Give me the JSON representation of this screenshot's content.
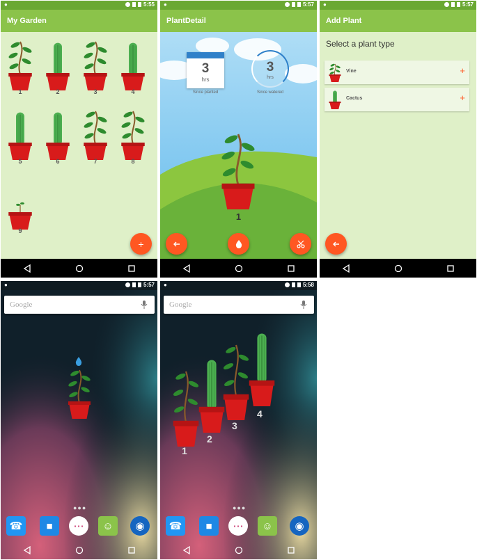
{
  "status": {
    "time1": "5:55",
    "time2": "5:57",
    "time3": "5:57",
    "time4": "5:57",
    "time5": "5:58"
  },
  "garden": {
    "title": "My Garden",
    "plants": [
      {
        "num": "1",
        "type": "vine"
      },
      {
        "num": "2",
        "type": "cactus"
      },
      {
        "num": "3",
        "type": "vine"
      },
      {
        "num": "4",
        "type": "cactus"
      },
      {
        "num": "5",
        "type": "cactus"
      },
      {
        "num": "6",
        "type": "cactus"
      },
      {
        "num": "7",
        "type": "vine"
      },
      {
        "num": "8",
        "type": "vine"
      },
      {
        "num": "9",
        "type": "sprout"
      }
    ],
    "fab_label": "+"
  },
  "detail": {
    "title": "PlantDetail",
    "planted_value": "3",
    "planted_unit": "hrs",
    "planted_label": "Since planted",
    "watered_value": "3",
    "watered_unit": "hrs",
    "watered_label": "Since watered",
    "plant_number": "1"
  },
  "add": {
    "title": "Add Plant",
    "heading": "Select a plant type",
    "items": [
      {
        "label": "Vine",
        "plus": "+"
      },
      {
        "label": "Cactus",
        "plus": "+"
      }
    ]
  },
  "home": {
    "search_text": "Google",
    "widget_labels": [
      "1",
      "2",
      "3",
      "4"
    ]
  },
  "colors": {
    "appbar": "#8bc34a",
    "accent": "#ff5722",
    "pot": "#d81b1b",
    "leaf": "#2e8b2e"
  }
}
